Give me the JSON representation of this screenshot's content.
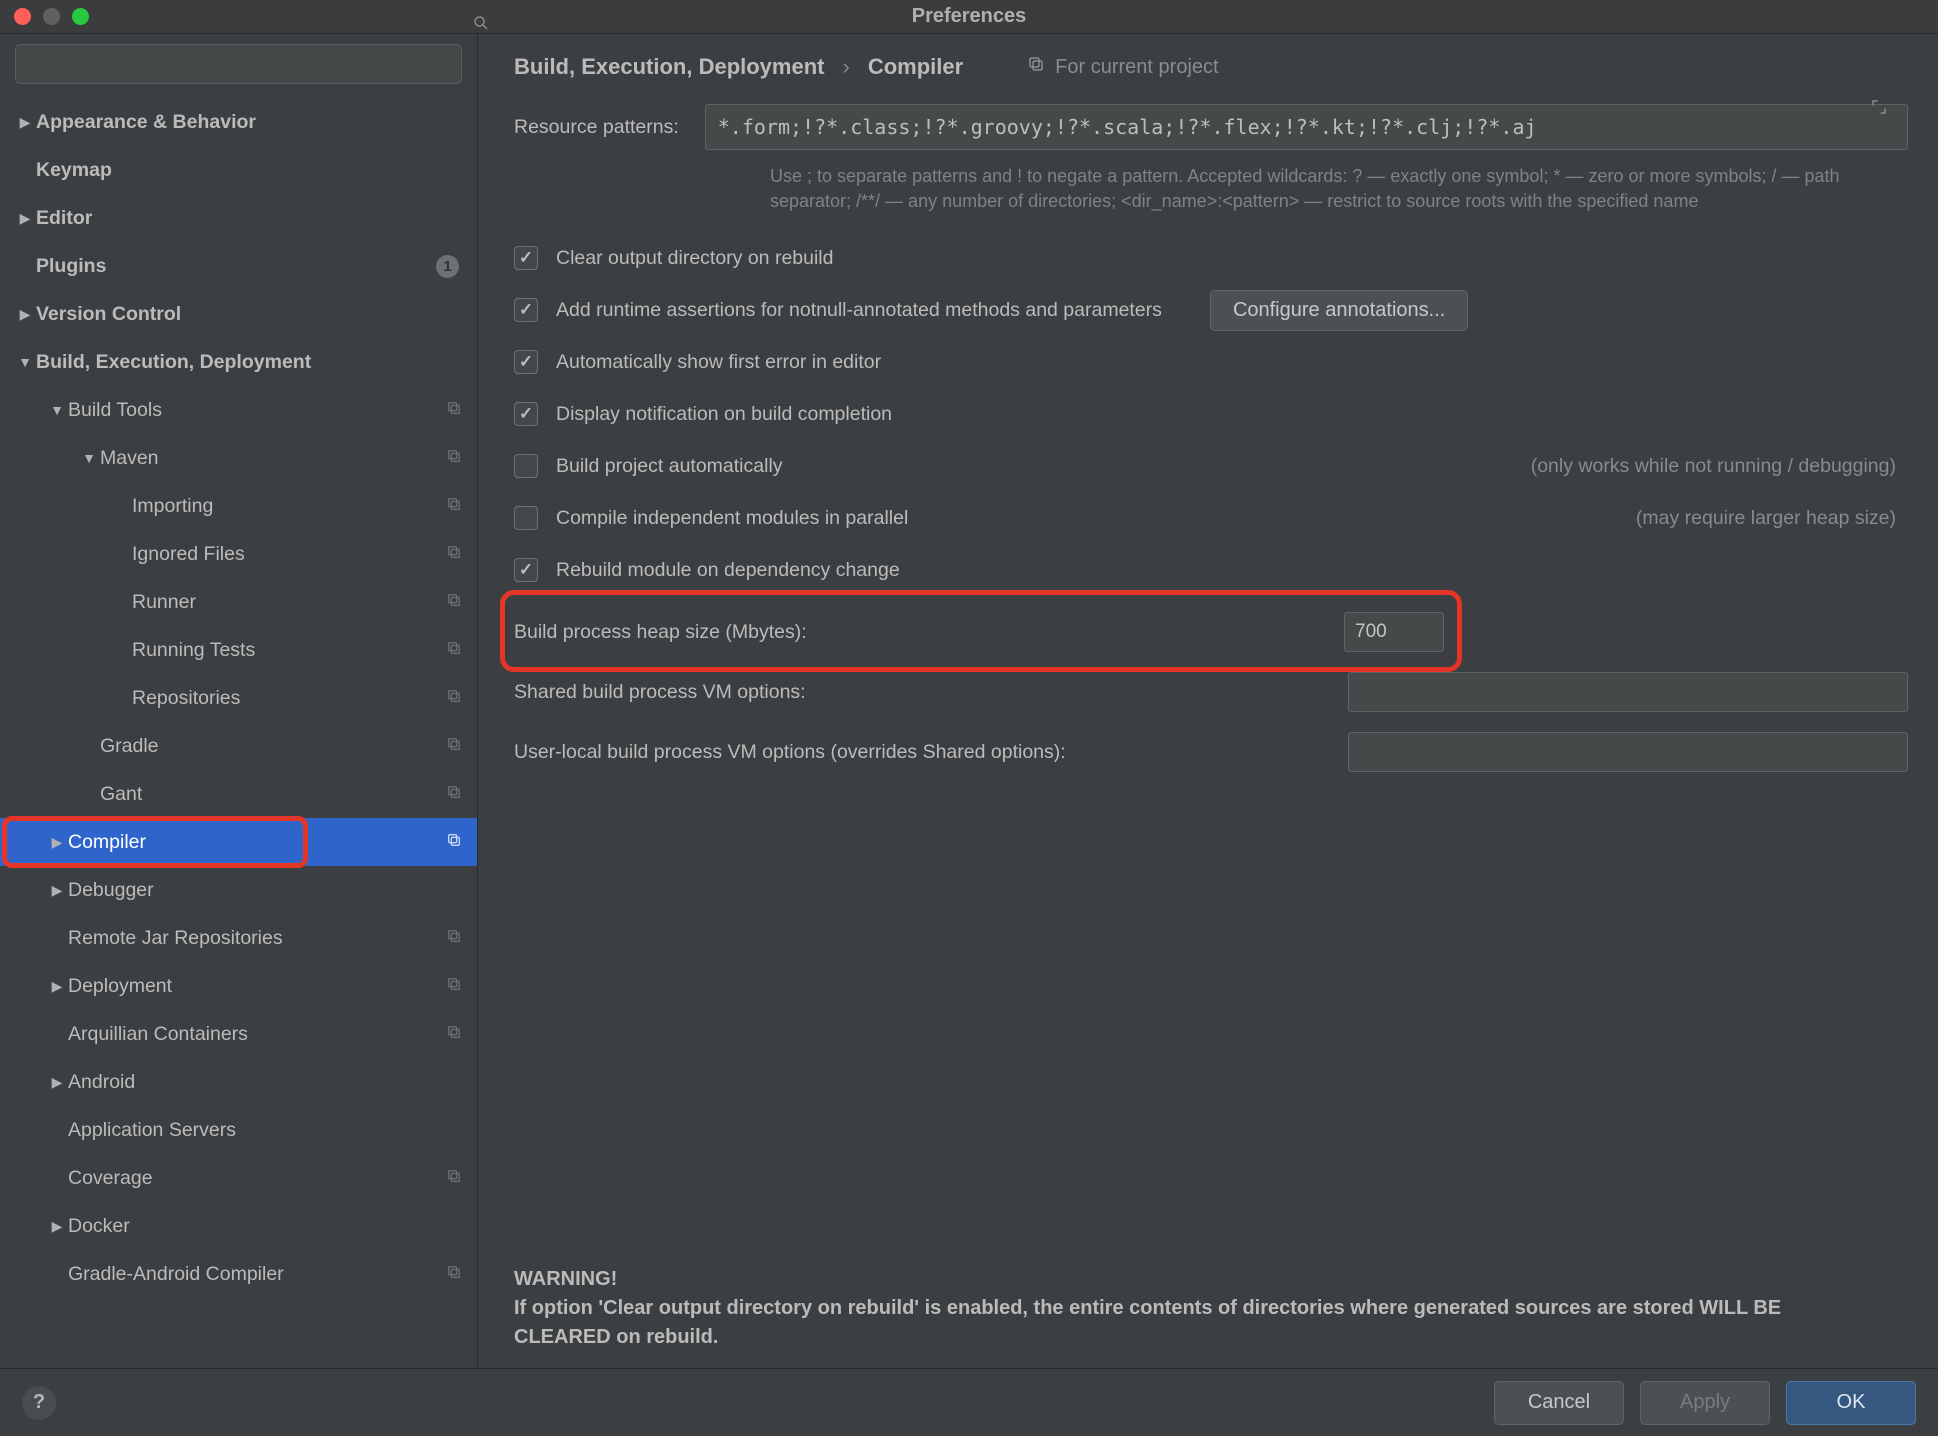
{
  "window": {
    "title": "Preferences"
  },
  "search": {
    "placeholder": ""
  },
  "sidebar": [
    {
      "label": "Appearance & Behavior",
      "bold": true,
      "arrow": "right",
      "indent": 0
    },
    {
      "label": "Keymap",
      "bold": true,
      "arrow": "none",
      "indent": 0
    },
    {
      "label": "Editor",
      "bold": true,
      "arrow": "right",
      "indent": 0
    },
    {
      "label": "Plugins",
      "bold": true,
      "arrow": "none",
      "indent": 0,
      "badge": "1"
    },
    {
      "label": "Version Control",
      "bold": true,
      "arrow": "right",
      "indent": 0
    },
    {
      "label": "Build, Execution, Deployment",
      "bold": true,
      "arrow": "down",
      "indent": 0
    },
    {
      "label": "Build Tools",
      "arrow": "down",
      "indent": 1,
      "copy": true
    },
    {
      "label": "Maven",
      "arrow": "down",
      "indent": 2,
      "copy": true
    },
    {
      "label": "Importing",
      "arrow": "none",
      "indent": 3,
      "copy": true
    },
    {
      "label": "Ignored Files",
      "arrow": "none",
      "indent": 3,
      "copy": true
    },
    {
      "label": "Runner",
      "arrow": "none",
      "indent": 3,
      "copy": true
    },
    {
      "label": "Running Tests",
      "arrow": "none",
      "indent": 3,
      "copy": true
    },
    {
      "label": "Repositories",
      "arrow": "none",
      "indent": 3,
      "copy": true
    },
    {
      "label": "Gradle",
      "arrow": "none",
      "indent": 2,
      "copy": true
    },
    {
      "label": "Gant",
      "arrow": "none",
      "indent": 2,
      "copy": true
    },
    {
      "label": "Compiler",
      "arrow": "right",
      "indent": 1,
      "copy": true,
      "selected": true
    },
    {
      "label": "Debugger",
      "arrow": "right",
      "indent": 1
    },
    {
      "label": "Remote Jar Repositories",
      "arrow": "none",
      "indent": 1,
      "copy": true
    },
    {
      "label": "Deployment",
      "arrow": "right",
      "indent": 1,
      "copy": true
    },
    {
      "label": "Arquillian Containers",
      "arrow": "none",
      "indent": 1,
      "copy": true
    },
    {
      "label": "Android",
      "arrow": "right",
      "indent": 1
    },
    {
      "label": "Application Servers",
      "arrow": "none",
      "indent": 1
    },
    {
      "label": "Coverage",
      "arrow": "none",
      "indent": 1,
      "copy": true
    },
    {
      "label": "Docker",
      "arrow": "right",
      "indent": 1
    },
    {
      "label": "Gradle-Android Compiler",
      "arrow": "none",
      "indent": 1,
      "copy": true
    }
  ],
  "breadcrumb": {
    "parent": "Build, Execution, Deployment",
    "child": "Compiler",
    "context": "For current project"
  },
  "patterns": {
    "label": "Resource patterns:",
    "value": "*.form;!?*.class;!?*.groovy;!?*.scala;!?*.flex;!?*.kt;!?*.clj;!?*.aj",
    "hint": "Use ; to separate patterns and ! to negate a pattern. Accepted wildcards: ? — exactly one symbol; * — zero or more symbols; / — path separator; /**/ — any number of directories; <dir_name>:<pattern> — restrict to source roots with the specified name"
  },
  "checks": [
    {
      "label": "Clear output directory on rebuild",
      "checked": true
    },
    {
      "label": "Add runtime assertions for notnull-annotated methods and parameters",
      "checked": true,
      "button": "Configure annotations..."
    },
    {
      "label": "Automatically show first error in editor",
      "checked": true
    },
    {
      "label": "Display notification on build completion",
      "checked": true
    },
    {
      "label": "Build project automatically",
      "checked": false,
      "note": "(only works while not running / debugging)"
    },
    {
      "label": "Compile independent modules in parallel",
      "checked": false,
      "note": "(may require larger heap size)"
    },
    {
      "label": "Rebuild module on dependency change",
      "checked": true
    }
  ],
  "fields": {
    "heap": {
      "label": "Build process heap size (Mbytes):",
      "value": "700"
    },
    "shared_vm": {
      "label": "Shared build process VM options:",
      "value": ""
    },
    "user_vm": {
      "label": "User-local build process VM options (overrides Shared options):",
      "value": ""
    }
  },
  "warning": "WARNING!\nIf option 'Clear output directory on rebuild' is enabled, the entire contents of directories where generated sources are stored WILL BE CLEARED on rebuild.",
  "footer": {
    "cancel": "Cancel",
    "apply": "Apply",
    "ok": "OK"
  }
}
